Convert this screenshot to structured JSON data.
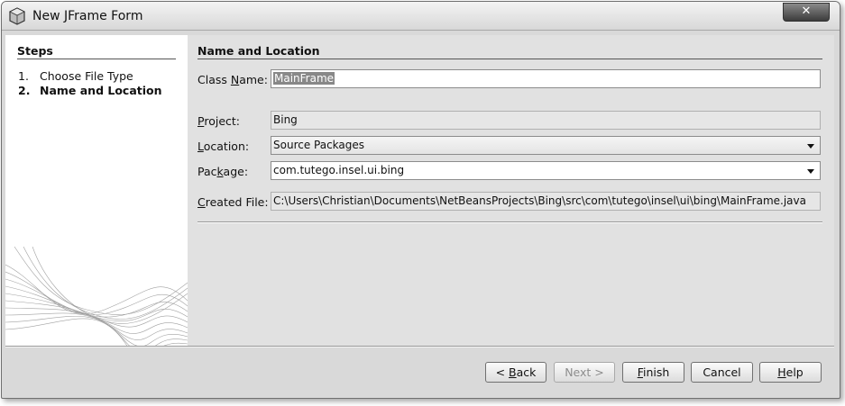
{
  "window": {
    "title": "New JFrame Form",
    "close_label": "✕"
  },
  "steps": {
    "title": "Steps",
    "items": [
      {
        "num": "1.",
        "label": "Choose File Type"
      },
      {
        "num": "2.",
        "label": "Name and Location"
      }
    ]
  },
  "form": {
    "section_title": "Name and Location",
    "class_name": {
      "label_pre": "Class ",
      "label_mn": "N",
      "label_post": "ame:",
      "value": "MainFrame"
    },
    "project": {
      "label_pre": "",
      "label_mn": "P",
      "label_post": "roject:",
      "value": "Bing"
    },
    "location": {
      "label_pre": "",
      "label_mn": "L",
      "label_post": "ocation:",
      "value": "Source Packages"
    },
    "package": {
      "label_pre": "Pac",
      "label_mn": "k",
      "label_post": "age:",
      "value": "com.tutego.insel.ui.bing"
    },
    "created_file": {
      "label_pre": "",
      "label_mn": "C",
      "label_post": "reated File:",
      "value": "C:\\Users\\Christian\\Documents\\NetBeansProjects\\Bing\\src\\com\\tutego\\insel\\ui\\bing\\MainFrame.java"
    }
  },
  "buttons": {
    "back": {
      "pre": "< ",
      "mn": "B",
      "post": "ack"
    },
    "next": {
      "label": "Next >"
    },
    "finish": {
      "pre": "",
      "mn": "F",
      "post": "inish"
    },
    "cancel": {
      "label": "Cancel"
    },
    "help": {
      "pre": "",
      "mn": "H",
      "post": "elp"
    }
  },
  "icons": {
    "app": "netbeans-cube-icon",
    "close": "close-icon",
    "dropdown": "chevron-down-icon"
  }
}
